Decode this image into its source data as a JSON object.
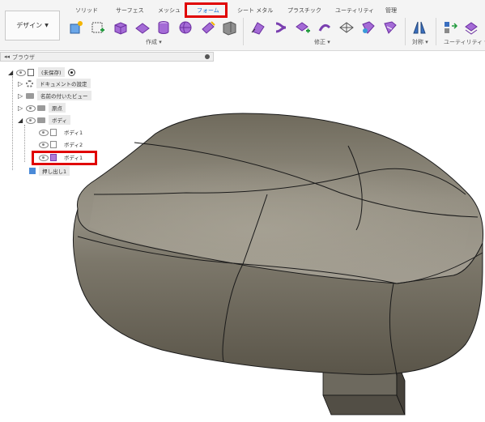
{
  "toolbar": {
    "design_label": "デザイン",
    "tabs": [
      {
        "label": "ソリッド"
      },
      {
        "label": "サーフェス"
      },
      {
        "label": "メッシュ"
      },
      {
        "label": "フォーム",
        "active": true
      },
      {
        "label": "シート メタル"
      },
      {
        "label": "プラスチック"
      },
      {
        "label": "ユーティリティ"
      },
      {
        "label": "管理"
      }
    ],
    "groups": {
      "create": "作成 ▾",
      "modify": "修正 ▾",
      "symmetry": "対称 ▾",
      "utility": "ユーティリティ ▾"
    },
    "accent_color": "#1a6fd0",
    "form_icon_color": "#9b59d0",
    "highlight_color": "#e00000"
  },
  "browser": {
    "title": "ブラウザ",
    "collapse_icon": "◂◂",
    "root_label": "(未保存)",
    "doc_settings": "ドキュメントの設定",
    "named_views": "名前の付いたビュー",
    "origin": "原点",
    "bodies_folder": "ボディ",
    "body_items": [
      "ボディ1",
      "ボディ2",
      "ボディ1"
    ],
    "feature": "押し出し1"
  },
  "viewport": {
    "body_color": "#7c776a",
    "edge_color": "#1a1a1a",
    "bg_color": "#ffffff"
  }
}
